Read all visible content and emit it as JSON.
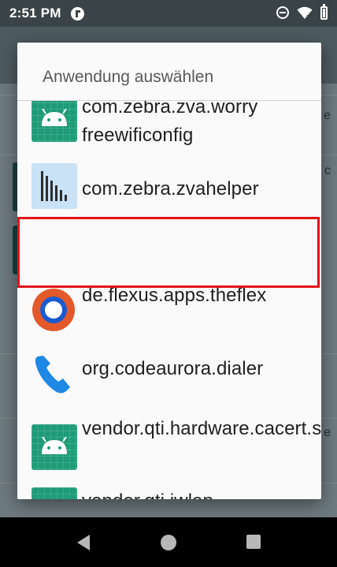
{
  "status_bar": {
    "time": "2:51 PM",
    "icons": [
      "app-notification-icon",
      "do-not-disturb-icon",
      "wifi-icon",
      "battery-icon"
    ]
  },
  "background": {
    "edge_chars": [
      "e",
      "c",
      "e"
    ],
    "star": "*"
  },
  "dialog": {
    "title": "Anwendung auswählen",
    "items": [
      {
        "label": "com.zebra.zva.worry freewificonfig",
        "icon": "android-icon"
      },
      {
        "label": "com.zebra.zvahelper",
        "icon": "zvahelper-icon"
      },
      {
        "label": "de.flexus.apps.theflex",
        "icon": "theflex-icon",
        "highlighted": true
      },
      {
        "label": "org.codeaurora.dialer",
        "icon": "phone-icon"
      },
      {
        "label": "vendor.qti.hardware.cacert.server",
        "icon": "android-icon"
      },
      {
        "label": "vendor.qti.iwlan",
        "icon": "android-icon"
      }
    ]
  },
  "navigation": {
    "buttons": [
      "back",
      "home",
      "recents"
    ]
  },
  "colors": {
    "highlight": "#e3141b",
    "android_tile": "#1e9b77",
    "dialer_blue": "#1e88e5",
    "flex_orange": "#e4592a",
    "flex_blue": "#1a5ad0"
  }
}
